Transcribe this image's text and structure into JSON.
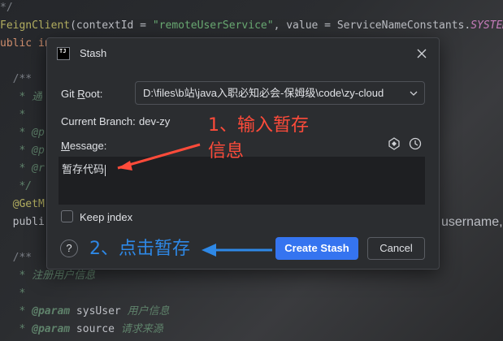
{
  "editor": {
    "lines": [
      {
        "parts": [
          {
            "c": "c-comment",
            "t": "*/"
          }
        ]
      },
      {
        "parts": [
          {
            "c": "c-annot",
            "t": "FeignClient"
          },
          {
            "c": "c-plain",
            "t": "(contextId = "
          },
          {
            "c": "c-str",
            "t": "\"remoteUserService\""
          },
          {
            "c": "c-plain",
            "t": ", value = ServiceNameConstants."
          },
          {
            "c": "c-const",
            "t": "SYSTEM"
          }
        ]
      },
      {
        "parts": [
          {
            "c": "c-kw",
            "t": "ublic in"
          }
        ]
      },
      {
        "parts": [
          {
            "c": "c-plain",
            "t": ""
          }
        ]
      },
      {
        "parts": [
          {
            "c": "c-comment",
            "t": "  /**"
          }
        ]
      },
      {
        "parts": [
          {
            "c": "c-italic",
            "t": "   * 通"
          }
        ]
      },
      {
        "parts": [
          {
            "c": "c-italic",
            "t": "   *"
          }
        ]
      },
      {
        "parts": [
          {
            "c": "c-italic",
            "t": "   * @p"
          }
        ]
      },
      {
        "parts": [
          {
            "c": "c-italic",
            "t": "   * @p"
          }
        ]
      },
      {
        "parts": [
          {
            "c": "c-italic",
            "t": "   * @r"
          }
        ]
      },
      {
        "parts": [
          {
            "c": "c-italic",
            "t": "   */"
          }
        ]
      },
      {
        "parts": [
          {
            "c": "c-annot",
            "t": "  @GetM"
          }
        ]
      },
      {
        "parts": [
          {
            "c": "c-plain",
            "t": "  publi"
          }
        ]
      },
      {
        "parts": [
          {
            "c": "c-plain",
            "t": ""
          }
        ]
      },
      {
        "parts": [
          {
            "c": "c-comment",
            "t": "  /**"
          }
        ]
      },
      {
        "parts": [
          {
            "c": "c-italic",
            "t": "   * 注册用户信息"
          }
        ]
      },
      {
        "parts": [
          {
            "c": "c-italic",
            "t": "   *"
          }
        ]
      },
      {
        "parts": [
          {
            "c": "c-italic",
            "t": "   * "
          },
          {
            "c": "c-tag",
            "t": "@param"
          },
          {
            "c": "c-ident",
            "t": " sysUser"
          },
          {
            "c": "c-italic",
            "t": " 用户信息"
          }
        ]
      },
      {
        "parts": [
          {
            "c": "c-italic",
            "t": "   * "
          },
          {
            "c": "c-tag",
            "t": "@param"
          },
          {
            "c": "c-ident",
            "t": " source"
          },
          {
            "c": "c-italic",
            "t": " 请求来源"
          }
        ]
      }
    ],
    "right_fragment": "username,"
  },
  "dialog": {
    "app_icon": "TJ",
    "title": "Stash",
    "git_root_label_pre": "Git ",
    "git_root_label_mn": "R",
    "git_root_label_post": "oot:",
    "git_root_value": "D:\\files\\b站\\java入职必知必会-保姆级\\code\\zy-cloud",
    "branch_label": "Current Branch:",
    "branch_value": "dev-zy",
    "message_label_mn": "M",
    "message_label_post": "essage:",
    "message_value": "暂存代码",
    "keep_index_pre": "Keep ",
    "keep_index_mn": "i",
    "keep_index_post": "ndex",
    "keep_index_checked": false,
    "help_label": "?",
    "create_label": "Create Stash",
    "cancel_label": "Cancel",
    "icons": [
      "close-icon",
      "chevron-down-icon",
      "ai-assistant-icon",
      "history-icon"
    ]
  },
  "annotations": {
    "step1_line1": "1、输入暂存",
    "step1_line2": "信息",
    "step2": "2、点击暂存",
    "step1_color": "#ff4b3a",
    "step2_color": "#2e88e6"
  },
  "colors": {
    "primary_button": "#3574f0",
    "dialog_bg": "#2b2d30",
    "editor_bg": "#1e1f22"
  }
}
